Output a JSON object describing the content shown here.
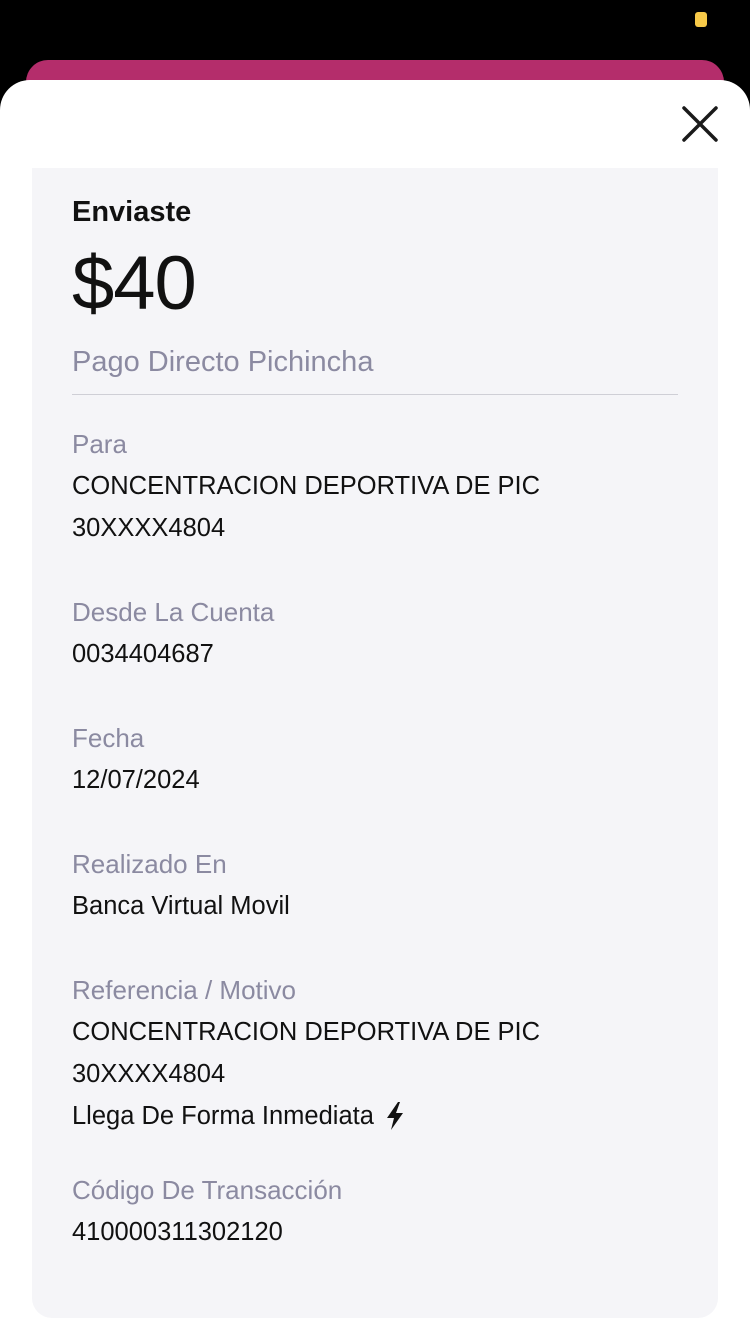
{
  "modal": {
    "close_label": "×"
  },
  "receipt": {
    "sent_label": "Enviaste",
    "amount": "$40",
    "payment_type": "Pago Directo Pichincha",
    "fields": {
      "para": {
        "label": "Para",
        "name": "CONCENTRACION DEPORTIVA DE PIC",
        "account": "30XXXX4804"
      },
      "desde": {
        "label": "Desde La Cuenta",
        "value": "0034404687"
      },
      "fecha": {
        "label": "Fecha",
        "value": "12/07/2024"
      },
      "realizado": {
        "label": "Realizado En",
        "value": "Banca Virtual Movil"
      },
      "referencia": {
        "label": "Referencia / Motivo",
        "name": "CONCENTRACION DEPORTIVA DE PIC",
        "account": "30XXXX4804",
        "note": "Llega De Forma Inmediata"
      },
      "codigo": {
        "label": "Código De Transacción",
        "value": "410000311302120"
      }
    }
  },
  "colors": {
    "accent": "#b42d6b",
    "label_gray": "#8b8aa1",
    "card_bg": "#f5f5f8",
    "status_yellow": "#f7c948"
  },
  "icons": {
    "close": "close-icon",
    "bolt": "lightning-bolt-icon"
  }
}
